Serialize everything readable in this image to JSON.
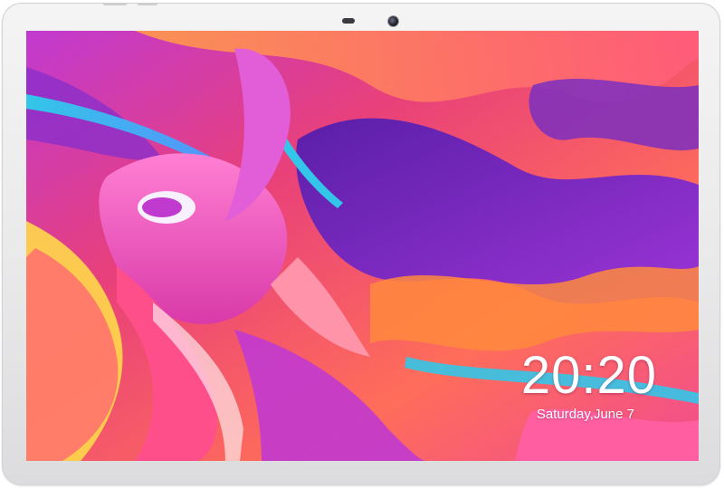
{
  "lock_screen": {
    "time": "20:20",
    "date": "Saturday,June 7"
  },
  "colors": {
    "bezel": "#ececee",
    "clock_text": "#ffffff",
    "wallpaper_magenta": "#e23f7f",
    "wallpaper_purple": "#7b2fbf",
    "wallpaper_orange": "#ff8a3d",
    "wallpaper_cyan": "#33c6e8",
    "wallpaper_yellow": "#ffd94a"
  },
  "icons": {
    "camera": "front-camera-icon",
    "sensor": "light-sensor-icon"
  }
}
